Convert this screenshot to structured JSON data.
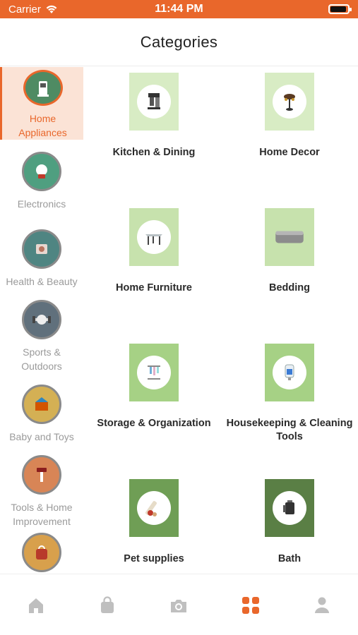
{
  "status_bar": {
    "carrier": "Carrier",
    "time": "11:44 PM"
  },
  "header": {
    "title": "Categories"
  },
  "colors": {
    "accent": "#e9672b",
    "active_bg": "#fbe3d6",
    "tab_inactive": "#bfbfbf"
  },
  "sidebar": {
    "items": [
      {
        "label": "Home\nAppliances",
        "icon": "appliance-icon",
        "color": "#4f8b63",
        "active": true
      },
      {
        "label": "Electronics",
        "icon": "electronics-icon",
        "color": "#4f9f80",
        "active": false
      },
      {
        "label": "Health & Beauty",
        "icon": "beauty-icon",
        "color": "#4f8582",
        "active": false
      },
      {
        "label": "Sports &\nOutdoors",
        "icon": "sports-icon",
        "color": "#60707c",
        "active": false
      },
      {
        "label": "Baby and Toys",
        "icon": "toys-icon",
        "color": "#d4b054",
        "active": false
      },
      {
        "label": "Tools & Home\nImprovement",
        "icon": "tools-icon",
        "color": "#d88556",
        "active": false
      },
      {
        "label": "",
        "icon": "bag-icon",
        "color": "#d8a04c",
        "active": false
      }
    ]
  },
  "categories": [
    {
      "label": "Kitchen & Dining",
      "icon": "coffee-machine-icon",
      "tile": "#d8ecc4"
    },
    {
      "label": "Home Decor",
      "icon": "decor-icon",
      "tile": "#d8ecc4"
    },
    {
      "label": "Home Furniture",
      "icon": "table-icon",
      "tile": "#c7e2ad"
    },
    {
      "label": "Bedding",
      "icon": "mattress-icon",
      "tile": "#c7e2ad"
    },
    {
      "label": "Storage & Organization",
      "icon": "rack-icon",
      "tile": "#a6d185"
    },
    {
      "label": "Housekeeping & Cleaning Tools",
      "icon": "dispenser-icon",
      "tile": "#a6d185"
    },
    {
      "label": "Pet supplies",
      "icon": "pet-icon",
      "tile": "#6f9e55"
    },
    {
      "label": "Bath",
      "icon": "bath-icon",
      "tile": "#5a7f45"
    }
  ],
  "tabbar": {
    "items": [
      {
        "icon": "home-icon",
        "active": false
      },
      {
        "icon": "shopping-bag-icon",
        "active": false
      },
      {
        "icon": "camera-icon",
        "active": false
      },
      {
        "icon": "categories-grid-icon",
        "active": true
      },
      {
        "icon": "profile-icon",
        "active": false
      }
    ]
  }
}
